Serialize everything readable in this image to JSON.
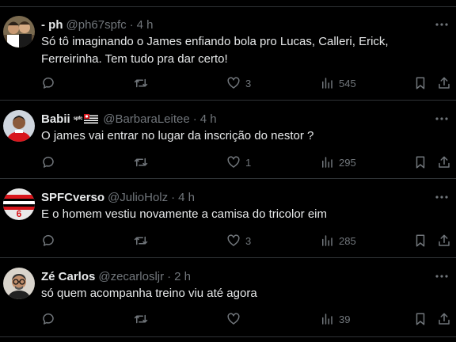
{
  "theme": {
    "background": "#000000",
    "text": "#e7e9ea",
    "muted": "#71767b",
    "divider": "#2f3336"
  },
  "replies": [
    {
      "display_name": "- ph",
      "handle": "@ph67spfc",
      "separator": "·",
      "time": "4 h",
      "text": "Só tô imaginando o James enfiando bola pro Lucas, Calleri, Erick, Ferreirinha. Tem tudo pra dar certo!",
      "likes": "3",
      "views": "545",
      "avatar_icon": "two-people-avatar"
    },
    {
      "display_name": "Babii",
      "name_badge": "spfc",
      "handle": "@BarbaraLeitee",
      "separator": "·",
      "time": "4 h",
      "text": "O james vai entrar no lugar da inscrição do nestor ?",
      "likes": "1",
      "views": "295",
      "avatar_icon": "red-jersey-player-avatar",
      "flag_icon": "sao-paulo-flag-icon"
    },
    {
      "display_name": "SPFCverso",
      "handle": "@JulioHolz",
      "separator": "·",
      "time": "4 h",
      "text": "E o homem vestiu novamente a camisa do tricolor eim",
      "likes": "3",
      "views": "285",
      "avatar_icon": "jersey-number-6-avatar",
      "avatar_number": "6"
    },
    {
      "display_name": "Zé Carlos",
      "handle": "@zecarlosljr",
      "separator": "·",
      "time": "2 h",
      "text": "só quem acompanha treino viu até agora",
      "likes": "",
      "views": "39",
      "avatar_icon": "man-with-glasses-avatar"
    }
  ]
}
